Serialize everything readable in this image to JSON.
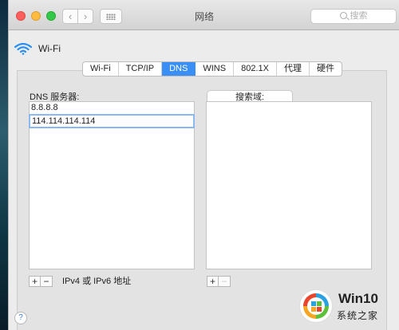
{
  "window": {
    "title": "网络",
    "search_placeholder": "搜索"
  },
  "interface": {
    "name": "Wi-Fi"
  },
  "tabs": [
    {
      "label": "Wi-Fi",
      "active": false
    },
    {
      "label": "TCP/IP",
      "active": false
    },
    {
      "label": "DNS",
      "active": true
    },
    {
      "label": "WINS",
      "active": false
    },
    {
      "label": "802.1X",
      "active": false
    },
    {
      "label": "代理",
      "active": false
    },
    {
      "label": "硬件",
      "active": false
    }
  ],
  "dns": {
    "label": "DNS 服务器:",
    "servers": [
      "8.8.8.8",
      "114.114.114.114"
    ],
    "hint": "IPv4 或 IPv6 地址"
  },
  "search_domains": {
    "label": "搜索域:",
    "items": []
  },
  "controls": {
    "add": "+",
    "remove": "−",
    "help": "?"
  },
  "watermark": {
    "line1": "Win10",
    "line2": "系统之家"
  },
  "colors": {
    "accent": "#3a8ff7",
    "close": "#fc605c",
    "minimize": "#fdbc40",
    "maximize": "#34c84a"
  }
}
